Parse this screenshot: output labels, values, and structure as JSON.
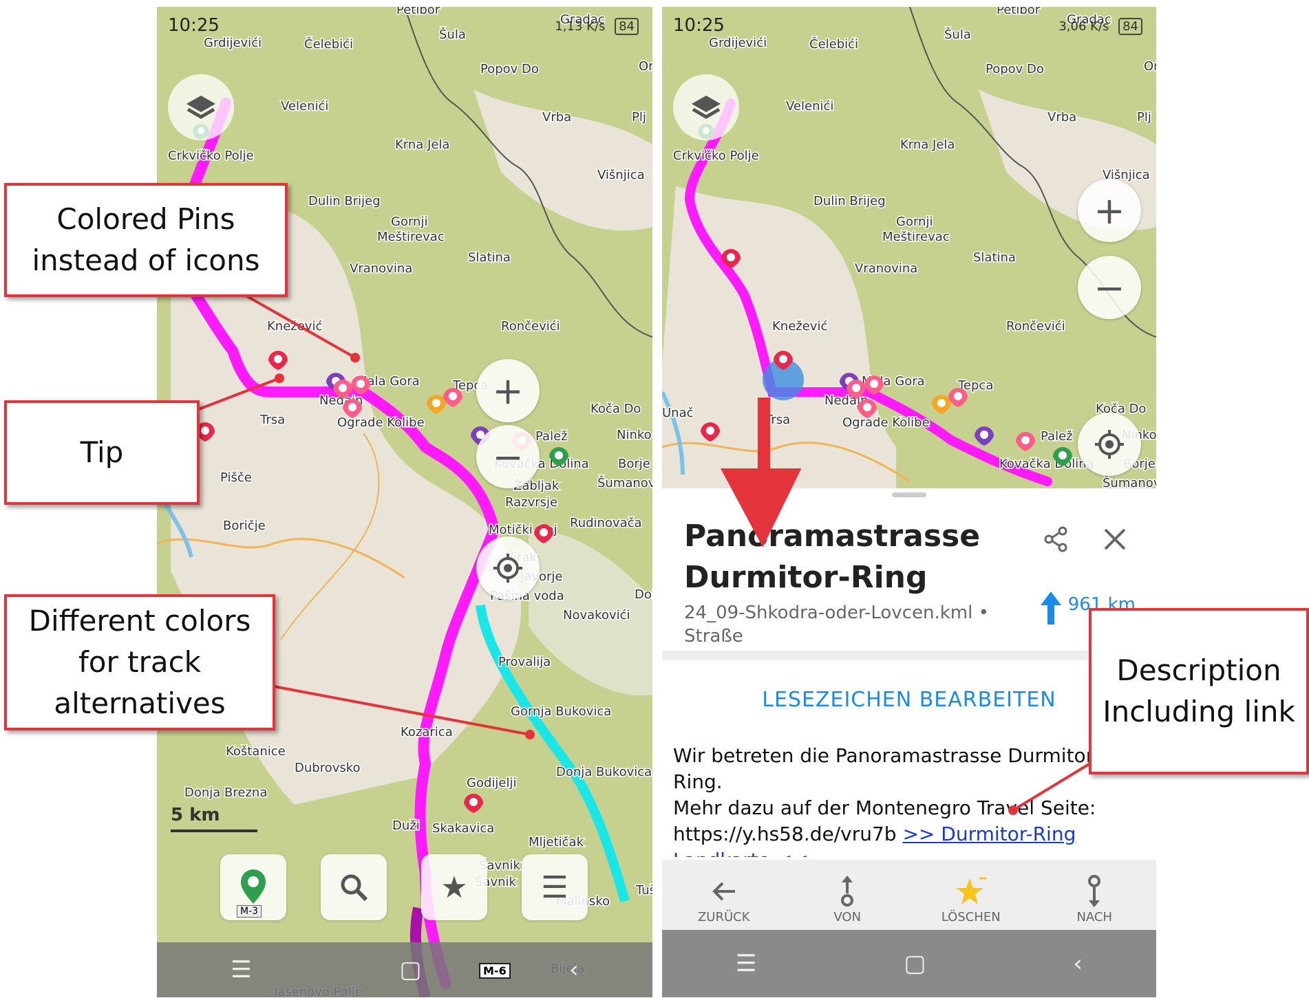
{
  "left_screen": {
    "status_time": "10:25",
    "status_net": "1,13 K/s",
    "battery": "84",
    "map_labels": [
      "Petibor",
      "Grdijevići",
      "Šula",
      "Čelebići",
      "Gradac",
      "Popov Do",
      "Or",
      "Velenići",
      "Vrba",
      "Plj",
      "Crkvičko Polje",
      "Krna Jela",
      "Višnjica",
      "Dulin Brijeg",
      "Gornji Meštirevac",
      "Slatina",
      "Vranovina",
      "Knežević",
      "Rončevići",
      "Mala Gora",
      "Nedajn",
      "Tepca",
      "Ograde Kolibe",
      "Koča Do",
      "Trsa",
      "Palež",
      "Ninko",
      "Kovačka Dolina",
      "Borje",
      "Pišče",
      "Žabljak",
      "Šumanov",
      "Razvrsje",
      "Rudinovača",
      "Boričje",
      "Motički Gaj",
      "Virak",
      "Javorje",
      "Dol",
      "Pašina voda",
      "Novakovići",
      "Provalija",
      "Gornja Bukovica",
      "Kozarica",
      "Koštanice",
      "Dubrovsko",
      "Donja Bukovica",
      "Godijelji",
      "Donja Brezna",
      "Duži",
      "Skakavica",
      "Mljetičak",
      "Šavnik",
      "Malinsko",
      "Tuš",
      "Bijela",
      "Jasenovo Polje"
    ],
    "scale_label": "5 km",
    "road_badges": [
      "M-3",
      "M-6"
    ]
  },
  "right_screen": {
    "status_time": "10:25",
    "status_net": "3,06 K/s",
    "battery": "84",
    "map_labels": [
      "Petibor",
      "Grdijevići",
      "Šula",
      "Čelebići",
      "Gradac",
      "Popov Do",
      "Or",
      "Velenići",
      "Vrba",
      "Plj",
      "Crkvičko Polje",
      "Krna Jela",
      "Višnjica",
      "Dulin Brijeg",
      "Gornji Meštirevac",
      "Slatina",
      "Vranovina",
      "Knežević",
      "Rončevići",
      "Mala Gora",
      "Nedajn",
      "Tepca",
      "Ograde Kolibe",
      "Koča Do",
      "Unač",
      "Trsa",
      "Palež",
      "Ninko",
      "Kovačka Dolina",
      "Borje",
      "Šumanov"
    ],
    "place_title": "Panoramastrasse Durmitor-Ring",
    "file_info": "24_09-Shkodra-oder-Lovcen.kml •",
    "category": "Straße",
    "distance": "961 km",
    "edit_bookmark": "LESEZEICHEN BEARBEITEN",
    "description_line1": "Wir betreten die Panoramastrasse Durmitor Ring.",
    "description_line2": "Mehr dazu auf der Montenegro Travel Seite:",
    "description_url": "https://y.hs58.de/vru7b",
    "description_link": ">> Durmitor-Ring",
    "description_cut": "Landkarte <<",
    "actions": [
      {
        "label": "ZURÜCK",
        "icon": "arrow-left-icon"
      },
      {
        "label": "VON",
        "icon": "route-start-icon"
      },
      {
        "label": "LÖSCHEN",
        "icon": "star-icon"
      },
      {
        "label": "NACH",
        "icon": "route-end-icon"
      }
    ]
  },
  "callouts": {
    "colored_pins": "Colored Pins instead of icons",
    "tip": "Tip",
    "track_colors": "Different colors for track alternatives",
    "description": "Description Including link"
  },
  "colors": {
    "track_main": "#ff1aff",
    "track_alt": "#19e6e6",
    "pin_red": "#e8274b",
    "pin_pink": "#ff5c8a",
    "pin_purple": "#7b3fbf",
    "pin_orange": "#f5a623",
    "pin_green": "#2e9e4f",
    "callout_border": "#e5333b",
    "link_blue": "#1a8be8"
  }
}
